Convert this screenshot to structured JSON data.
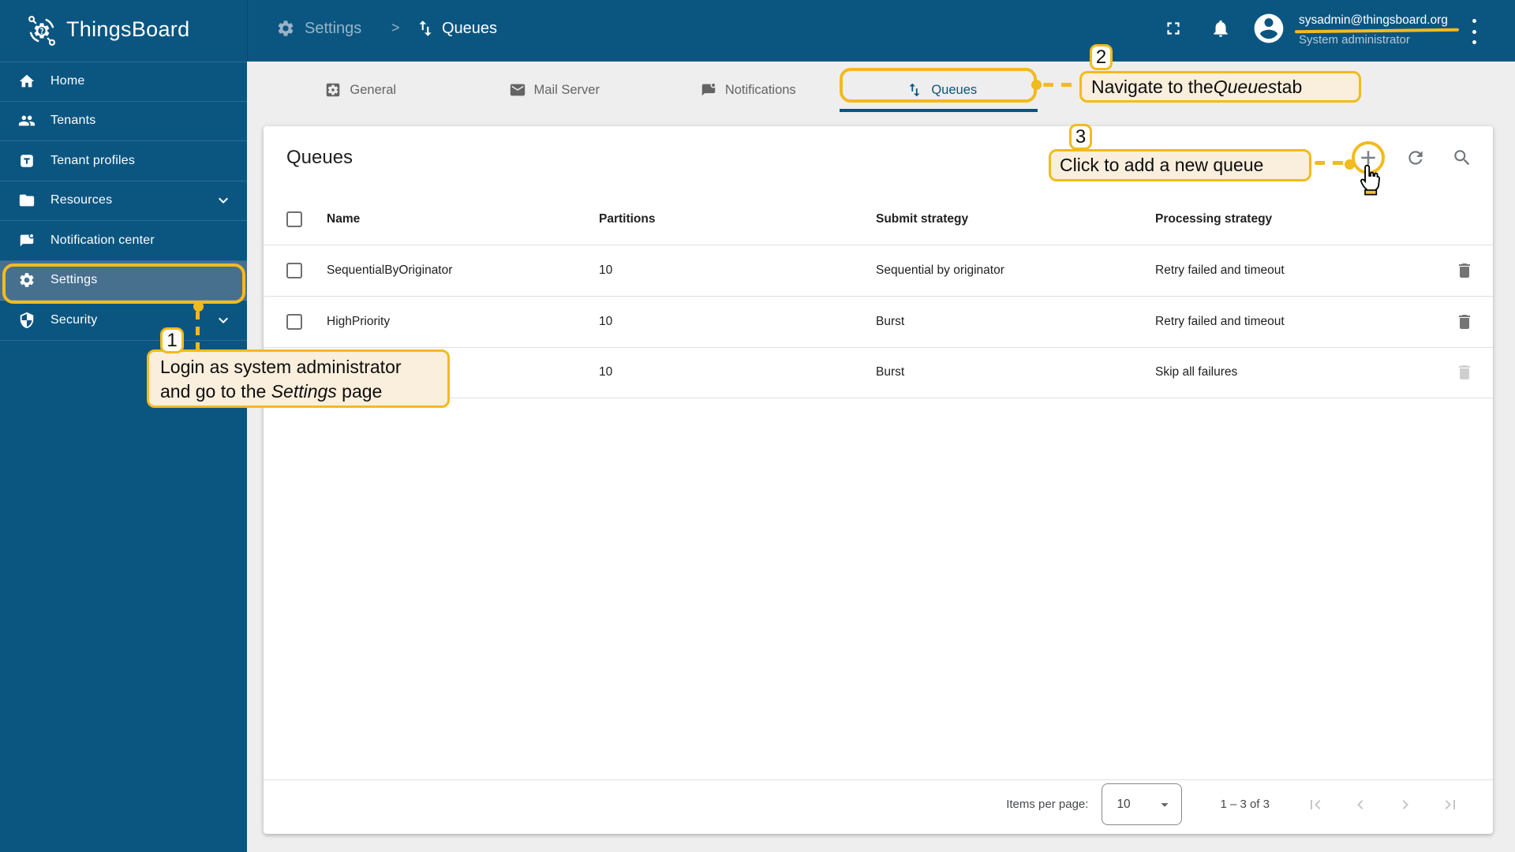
{
  "colors": {
    "primary": "#0b5681",
    "selected_item": "#47708f",
    "accent_yellow": "#f2bb1d",
    "callout_bg": "#faeedc",
    "badge_bg": "#fffdf6",
    "content_bg": "#eeeeee",
    "card_bg": "#ffffff",
    "muted_breadcrumb": "#9ab3c6",
    "tab_inactive": "#646464",
    "tab_active": "#0d547c",
    "text_dark": "#212121",
    "icon_gray": "#757575",
    "divider": "#e0e0e0",
    "disabled_icon": "#cfcfcf",
    "pagination_disabled": "#c4c7ca",
    "footer_text": "#46494c",
    "sidebar_divider": "rgba(255,255,255,0.13)"
  },
  "header": {
    "brand": "ThingsBoard",
    "breadcrumb": {
      "section": "Settings",
      "separator": ">",
      "page": "Queues"
    },
    "user": {
      "email": "sysadmin@thingsboard.org",
      "role": "System administrator"
    }
  },
  "sidebar": {
    "items": [
      {
        "label": "Home",
        "icon": "home-icon"
      },
      {
        "label": "Tenants",
        "icon": "people-icon"
      },
      {
        "label": "Tenant profiles",
        "icon": "tenant-profile-icon"
      },
      {
        "label": "Resources",
        "icon": "folder-icon",
        "expandable": true
      },
      {
        "label": "Notification center",
        "icon": "message-badge-icon"
      },
      {
        "label": "Settings",
        "icon": "gear-icon",
        "selected": true,
        "highlighted": true
      },
      {
        "label": "Security",
        "icon": "shield-icon",
        "expandable": true
      }
    ]
  },
  "tabs": [
    {
      "label": "General",
      "icon": "settings-square-icon"
    },
    {
      "label": "Mail Server",
      "icon": "mail-icon"
    },
    {
      "label": "Notifications",
      "icon": "message-badge-icon"
    },
    {
      "label": "Queues",
      "icon": "swap-vert-icon",
      "active": true,
      "highlighted": true
    }
  ],
  "queues": {
    "title": "Queues",
    "columns": [
      "Name",
      "Partitions",
      "Submit strategy",
      "Processing strategy"
    ],
    "rows": [
      {
        "name": "SequentialByOriginator",
        "partitions": "10",
        "submit_strategy": "Sequential by originator",
        "processing_strategy": "Retry failed and timeout",
        "delete_enabled": true
      },
      {
        "name": "HighPriority",
        "partitions": "10",
        "submit_strategy": "Burst",
        "processing_strategy": "Retry failed and timeout",
        "delete_enabled": true
      },
      {
        "name": "",
        "partitions": "10",
        "submit_strategy": "Burst",
        "processing_strategy": "Skip all failures",
        "delete_enabled": false
      }
    ],
    "footer": {
      "items_per_page_label": "Items per page:",
      "items_per_page_value": "10",
      "range": "1 – 3 of 3"
    }
  },
  "annotations": {
    "step1": {
      "number": "1",
      "pre": "Login as system administrator and go to the ",
      "em": "Settings",
      "post": " page"
    },
    "step2": {
      "number": "2",
      "pre": "Navigate to the ",
      "em": "Queues",
      "post": " tab"
    },
    "step3": {
      "number": "3",
      "text": "Click to add a new queue"
    }
  }
}
